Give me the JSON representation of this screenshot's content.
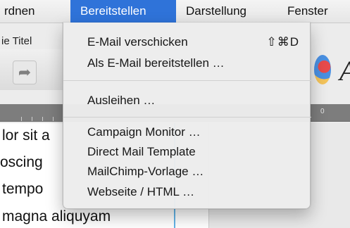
{
  "menubar": {
    "items": [
      {
        "label": "rdnen",
        "active": false
      },
      {
        "label": "Bereitstellen",
        "active": true
      },
      {
        "label": "Darstellung",
        "active": false
      },
      {
        "label": "Fenster",
        "active": false
      }
    ]
  },
  "document": {
    "title_fragment": "ie Titel",
    "lines": [
      "lor sit a",
      "oscing",
      "tempo",
      "magna aliquyam"
    ]
  },
  "menu": {
    "items": [
      {
        "label": "E-Mail verschicken",
        "shortcut": "⇧⌘D"
      },
      {
        "label": "Als E-Mail bereitstellen …"
      },
      {
        "label": "Ausleihen …"
      },
      {
        "label": "Campaign Monitor …"
      },
      {
        "label": "Direct Mail Template"
      },
      {
        "label": "MailChimp-Vorlage …"
      },
      {
        "label": "Webseite / HTML …"
      }
    ]
  },
  "ruler": {
    "number": "0"
  },
  "colors": {
    "accent": "#2f73d9",
    "cursor": "#63b4e8"
  }
}
